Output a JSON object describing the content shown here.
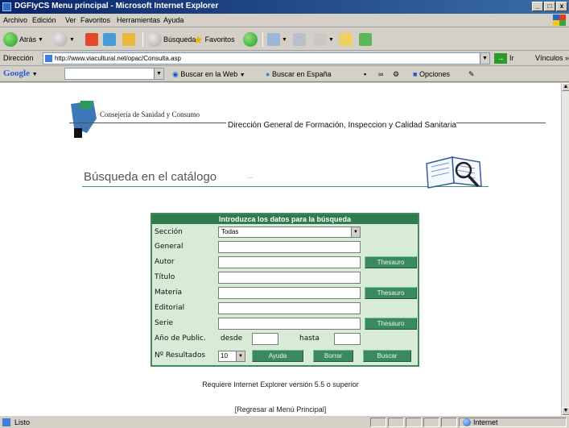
{
  "window": {
    "title": "DGFIyCS Menu principal - Microsoft Internet Explorer",
    "buttons": [
      "_",
      "□",
      "x"
    ]
  },
  "menu": {
    "items": [
      "Archivo",
      "Edición",
      "Ver",
      "Favoritos",
      "Herramientas",
      "Ayuda"
    ]
  },
  "toolbar": {
    "back_label": "Atrás",
    "search_label": "Búsqueda",
    "favorites_label": "Favoritos"
  },
  "address": {
    "label": "Dirección",
    "url": "http://www.viacultural.net/opac/Consulta.asp",
    "go_label": "Ir",
    "links_label": "Vínculos »"
  },
  "google": {
    "logo": "Google",
    "search_web": "Buscar en la Web",
    "search_spain": "Buscar en España",
    "options": "Opciones"
  },
  "page": {
    "org_name": "Consejería de Sanidad y Consumo",
    "dept_name": "Dirección General de Formación, Inspeccion y Calidad Sanitaria",
    "search_title": "Búsqueda en el catálogo",
    "search_title_dots": "...",
    "form_title": "Introduzca los datos para la búsqueda",
    "fields": {
      "seccion": "Sección",
      "general": "General",
      "autor": "Autor",
      "titulo": "Título",
      "materia": "Materia",
      "editorial": "Editorial",
      "serie": "Serie",
      "anio": "Año de Public.",
      "desde": "desde",
      "hasta": "hasta",
      "nresultados": "Nº Resultados"
    },
    "seccion_value": "Todas",
    "nresultados_value": "10",
    "buttons": {
      "thesauro": "Thesauro",
      "ayuda": "Ayuda",
      "borrar": "Borrar",
      "buscar": "Buscar"
    },
    "requirement": "Requiere Internet Explorer versión 5.5 o superior",
    "back_link": "[Regresar al Menú Principal]"
  },
  "status": {
    "text": "Listo",
    "zone": "Internet"
  }
}
